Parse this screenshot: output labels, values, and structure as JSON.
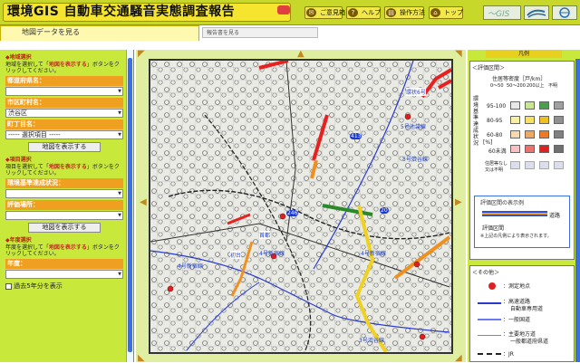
{
  "header": {
    "logo_text": "環境GIS 自動車交通騒音実態調査報告",
    "buttons": [
      {
        "label": "ご意見箱",
        "icon": "mail-icon"
      },
      {
        "label": "ヘルプ",
        "icon": "help-icon"
      },
      {
        "label": "操作方法",
        "icon": "book-icon"
      },
      {
        "label": "トップ",
        "icon": "home-icon"
      }
    ]
  },
  "tabs": {
    "map_data": "地図データを見る",
    "report": "報告書を見る"
  },
  "sidebar": {
    "sec1_title": "◆地域選択",
    "sec1_desc_pre": "地域を選択して「",
    "sec1_desc_btn": "地図を表示する",
    "sec1_desc_post": "」ボタンをクリックしてください。",
    "pref_label": "都道府県名：",
    "pref_value": "",
    "city_label": "市区町村名：",
    "city_value": "渋谷区",
    "town_label": "町丁目名：",
    "town_value": "----- 選択項目 -----",
    "show_btn": "地図を表示する",
    "sec2_title": "◆項目選択",
    "sec2_desc_pre": "項目を選択して「",
    "sec2_desc_btn": "地図を表示する",
    "sec2_desc_post": "」ボタンをクリックしてください。",
    "env_label": "環境基準達成状況：",
    "env_value": "",
    "eval_label": "評価場所：",
    "eval_value": "",
    "show_btn2": "地図を表示する",
    "sec3_title": "◆年度選択",
    "sec3_desc_pre": "年度を選択して「",
    "sec3_desc_btn": "地図を表示する",
    "sec3_desc_post": "」ボタンをクリックしてください。",
    "year_label": "年度：",
    "year_value": "",
    "past_check": "過去5年分を表示"
  },
  "map": {
    "labels": [
      "5号池袋線",
      "環状6号",
      "246",
      "4号新宿線",
      "4号新宿線",
      "初台",
      "4号新宿線",
      "3号渋谷線",
      "3号渋谷線",
      "首都",
      "20",
      "413"
    ]
  },
  "legend": {
    "title": "凡例",
    "eval_title": "＜評価区間＞",
    "density_label": "住居等密度［戸/km］",
    "density_cols": [
      "0～50",
      "50～200",
      "200以上",
      "不明"
    ],
    "vertical_label": "環境基準達成状況",
    "pct_label": "[%]",
    "rows": [
      "95-100",
      "80-95",
      "60-80",
      "60未満"
    ],
    "no_res": "住居等なし又は不明",
    "ex_title": "評価区間の表示例",
    "ex_road": "道路",
    "ex_eval": "評価区間",
    "ex_note": "※上記の凡例により表示されます。",
    "other_title": "＜その他＞",
    "point_label": "：測定地点",
    "highway_label": "：高速道路",
    "highway_sub": "自動車専用道",
    "national_label": "：一般国道",
    "major_label": "：主要地方道",
    "major_sub": "一般都道府県道",
    "jr_label": "：JR"
  },
  "colors": {
    "header": "#c8d82a",
    "sidebar": "#c8e83c",
    "orange": "#f0a020",
    "scroll": "#3a70e0"
  }
}
